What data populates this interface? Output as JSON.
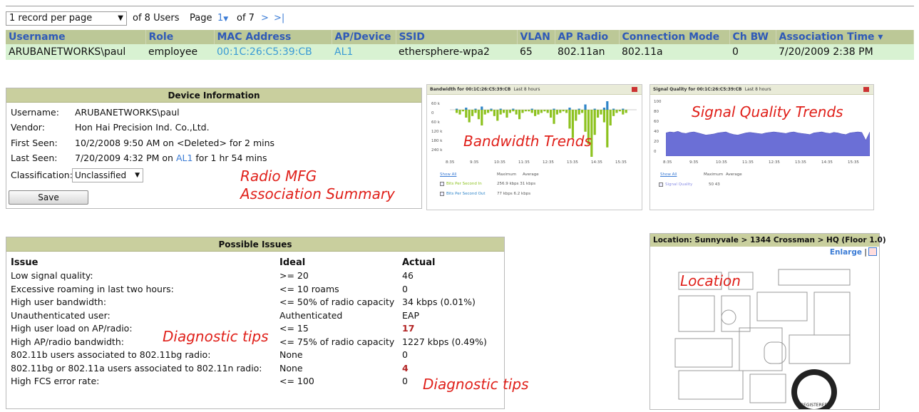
{
  "pager": {
    "per_page": "1 record per page",
    "of_users": "of 8 Users",
    "page_label": "Page",
    "page_current": "1",
    "of_pages": "of 7",
    "next": ">",
    "last": ">|"
  },
  "users_table": {
    "headers": [
      "Username",
      "Role",
      "MAC Address",
      "AP/Device",
      "SSID",
      "VLAN",
      "AP Radio",
      "Connection Mode",
      "Ch BW",
      "Association Time ▾"
    ],
    "row": [
      "ARUBANETWORKS\\paul",
      "employee",
      "00:1C:26:C5:39:CB",
      "AL1",
      "ethersphere-wpa2",
      "65",
      "802.11an",
      "802.11a",
      "0",
      "7/20/2009 2:38 PM"
    ]
  },
  "device_info": {
    "title": "Device Information",
    "username_k": "Username:",
    "username_v": "ARUBANETWORKS\\paul",
    "vendor_k": "Vendor:",
    "vendor_v": "Hon Hai Precision Ind. Co.,Ltd.",
    "first_k": "First Seen:",
    "first_v": "10/2/2008 9:50 AM on <Deleted> for 2 mins",
    "last_k": "Last Seen:",
    "last_v_pre": "7/20/2009 4:32 PM on ",
    "last_v_link": "AL1",
    "last_v_post": " for 1 hr 54 mins",
    "class_k": "Classification:",
    "class_v": "Unclassified",
    "save": "Save"
  },
  "bandwidth": {
    "title": "Bandwidth for 00:1C:26:C5:39:CB",
    "range": "Last 8 hours",
    "yticks": [
      "60 k",
      "0",
      "60 k",
      "120 k",
      "180 k",
      "240 k"
    ],
    "xticks": [
      "8:35",
      "9:35",
      "10:35",
      "11:35",
      "12:35",
      "13:35",
      "14:35",
      "15:35"
    ],
    "show_all": "Show All",
    "max_label": "Maximum",
    "avg_label": "Average",
    "in_label": "Bits Per Second In",
    "in_vals": "256.9 kbps  31 kbps",
    "out_label": "Bits Per Second Out",
    "out_vals": "77 kbps  6.2 kbps"
  },
  "signal": {
    "title": "Signal Quality for 00:1C:26:C5:39:CB",
    "range": "Last 8 hours",
    "yticks": [
      "100",
      "80",
      "60",
      "40",
      "20",
      "0"
    ],
    "xticks": [
      "8:35",
      "9:35",
      "10:35",
      "11:35",
      "12:35",
      "13:35",
      "14:35",
      "15:35"
    ],
    "show_all": "Show All",
    "max_label": "Maximum",
    "avg_label": "Average",
    "sq_label": "Signal Quality",
    "sq_vals": "50     43"
  },
  "issues": {
    "title": "Possible Issues",
    "headers": [
      "Issue",
      "Ideal",
      "Actual"
    ],
    "rows": [
      [
        "Low signal quality:",
        ">= 20",
        "46"
      ],
      [
        "Excessive roaming in last two hours:",
        "<= 10 roams",
        "0"
      ],
      [
        "High user bandwidth:",
        "<= 50% of radio capacity",
        "34 kbps (0.01%)"
      ],
      [
        "Unauthenticated user:",
        "Authenticated",
        "EAP"
      ],
      [
        "High user load on AP/radio:",
        "<= 15",
        "17"
      ],
      [
        "High AP/radio bandwidth:",
        "<= 75% of radio capacity",
        "1227 kbps (0.49%)"
      ],
      [
        "802.11b users associated to 802.11bg radio:",
        "None",
        "0"
      ],
      [
        "802.11bg or 802.11a users associated to 802.11n radio:",
        "None",
        "4"
      ],
      [
        "High FCS error rate:",
        "<= 100",
        "0"
      ]
    ]
  },
  "location": {
    "title": "Location: Sunnyvale > 1344 Crossman > HQ (Floor 1.0)",
    "enlarge": "Enlarge",
    "sep": "|",
    "stamp_text": "REGISTERED"
  },
  "annotations": {
    "radio_mfg": "Radio MFG",
    "assoc_summary": "Association Summary",
    "bandwidth_trends": "Bandwidth Trends",
    "signal_trends": "Signal Quality Trends",
    "diag1": "Diagnostic tips",
    "diag2": "Diagnostic tips",
    "location": "Location"
  },
  "colors": {
    "header_bg": "#bcc897",
    "row_bg": "#d8f2d2",
    "panel_head": "#c9cf9e",
    "annot_red": "#e0201a",
    "bw_in": "#8dc21f",
    "bw_out": "#2e84c9",
    "signal_fill": "#6b6fd6"
  }
}
